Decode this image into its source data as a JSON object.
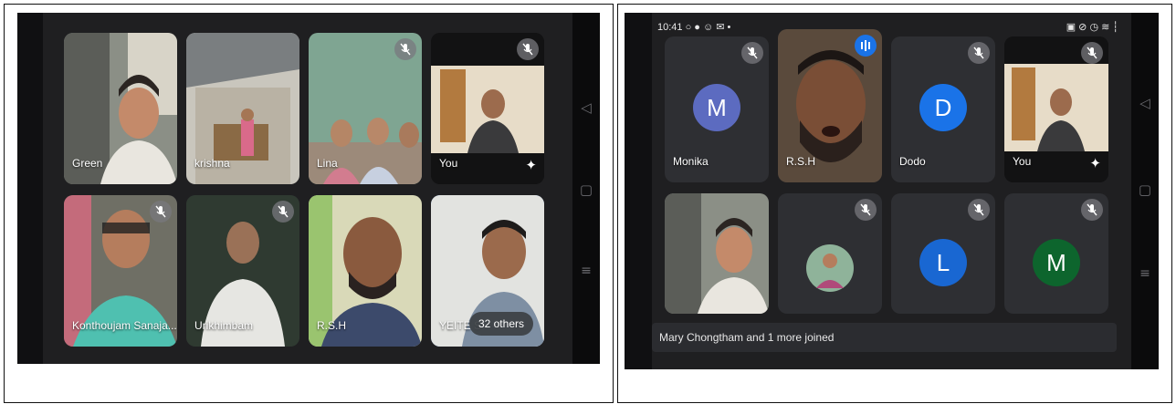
{
  "left_screen": {
    "tiles": [
      {
        "name": "Green",
        "muted": false
      },
      {
        "name": "krishna",
        "muted": false
      },
      {
        "name": "Lina",
        "muted": true
      },
      {
        "name": "You",
        "muted": true,
        "effects_icon": "sparkle-icon"
      },
      {
        "name": "Konthoujam Sanaja...",
        "muted": true
      },
      {
        "name": "Urikhimbam",
        "muted": true
      },
      {
        "name": "R.S.H",
        "muted": false
      },
      {
        "name": "YEITE S",
        "muted": false,
        "others_label": "32 others"
      }
    ]
  },
  "right_screen": {
    "status_bar": {
      "time": "10:41",
      "left_icons": "○ ● ☺ ✉ •",
      "right_icons": "▣ ⊘ ◷ ≋ ┆"
    },
    "tiles": [
      {
        "name": "Monika",
        "letter": "M",
        "avatar_color": "#5c6bc0",
        "muted": true
      },
      {
        "name": "R.S.H",
        "speaking": true
      },
      {
        "name": "Dodo",
        "letter": "D",
        "avatar_color": "#1a73e8",
        "muted": true
      },
      {
        "name": "You",
        "muted": true,
        "effects_icon": "sparkle-icon"
      },
      {
        "name": "",
        "muted": false
      },
      {
        "name": "",
        "muted": true
      },
      {
        "name": "",
        "letter": "L",
        "avatar_color": "#1967d2",
        "muted": true
      },
      {
        "name": "",
        "letter": "M",
        "avatar_color": "#0d652d",
        "muted": true
      }
    ],
    "toast": "Mary Chongtham and 1 more joined"
  }
}
